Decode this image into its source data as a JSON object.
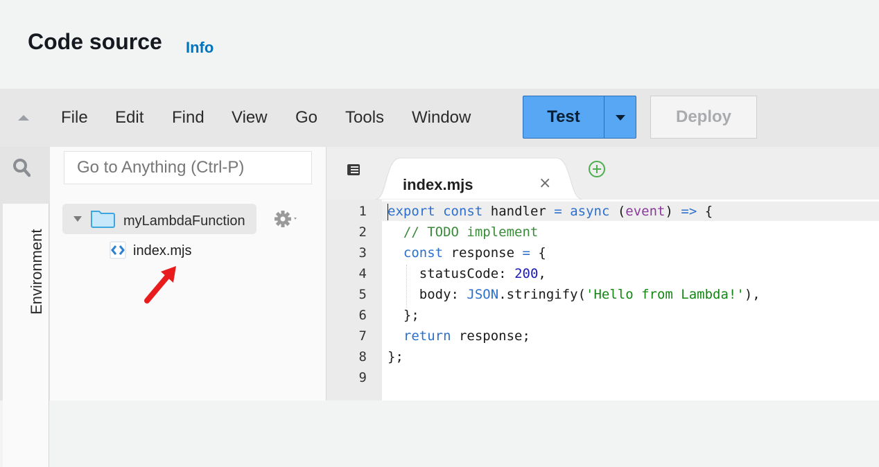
{
  "header": {
    "title": "Code source",
    "info_link": "Info"
  },
  "menubar": {
    "items": [
      "File",
      "Edit",
      "Find",
      "View",
      "Go",
      "Tools",
      "Window"
    ],
    "test_label": "Test",
    "deploy_label": "Deploy"
  },
  "sidebar": {
    "environment_tab": "Environment",
    "goto_placeholder": "Go to Anything (Ctrl-P)",
    "folder": "myLambdaFunction",
    "file": "index.mjs"
  },
  "editor": {
    "tab_label": "index.mjs",
    "close_glyph": "×",
    "line_numbers": [
      "1",
      "2",
      "3",
      "4",
      "5",
      "6",
      "7",
      "8",
      "9"
    ],
    "code": {
      "l1_export": "export",
      "l1_const": "const",
      "l1_handler": "handler",
      "l1_eq": "=",
      "l1_async": "async",
      "l1_event": "event",
      "l1_arrow": "=>",
      "l2_comment": "// TODO implement",
      "l3_const": "const",
      "l3_response": "response",
      "l3_eq": "=",
      "l4_key": "statusCode:",
      "l4_num": "200",
      "l5_key": "body:",
      "l5_json": "JSON",
      "l5_method": ".stringify(",
      "l5_str": "'Hello from Lambda!'",
      "l5_end": "),",
      "l6": "};",
      "l7_return": "return",
      "l7_rest": "response;",
      "l8": "};"
    }
  },
  "colors": {
    "test_button": "#57a7f5",
    "info_link": "#0073bb",
    "annotation_arrow": "#e81c1c"
  }
}
